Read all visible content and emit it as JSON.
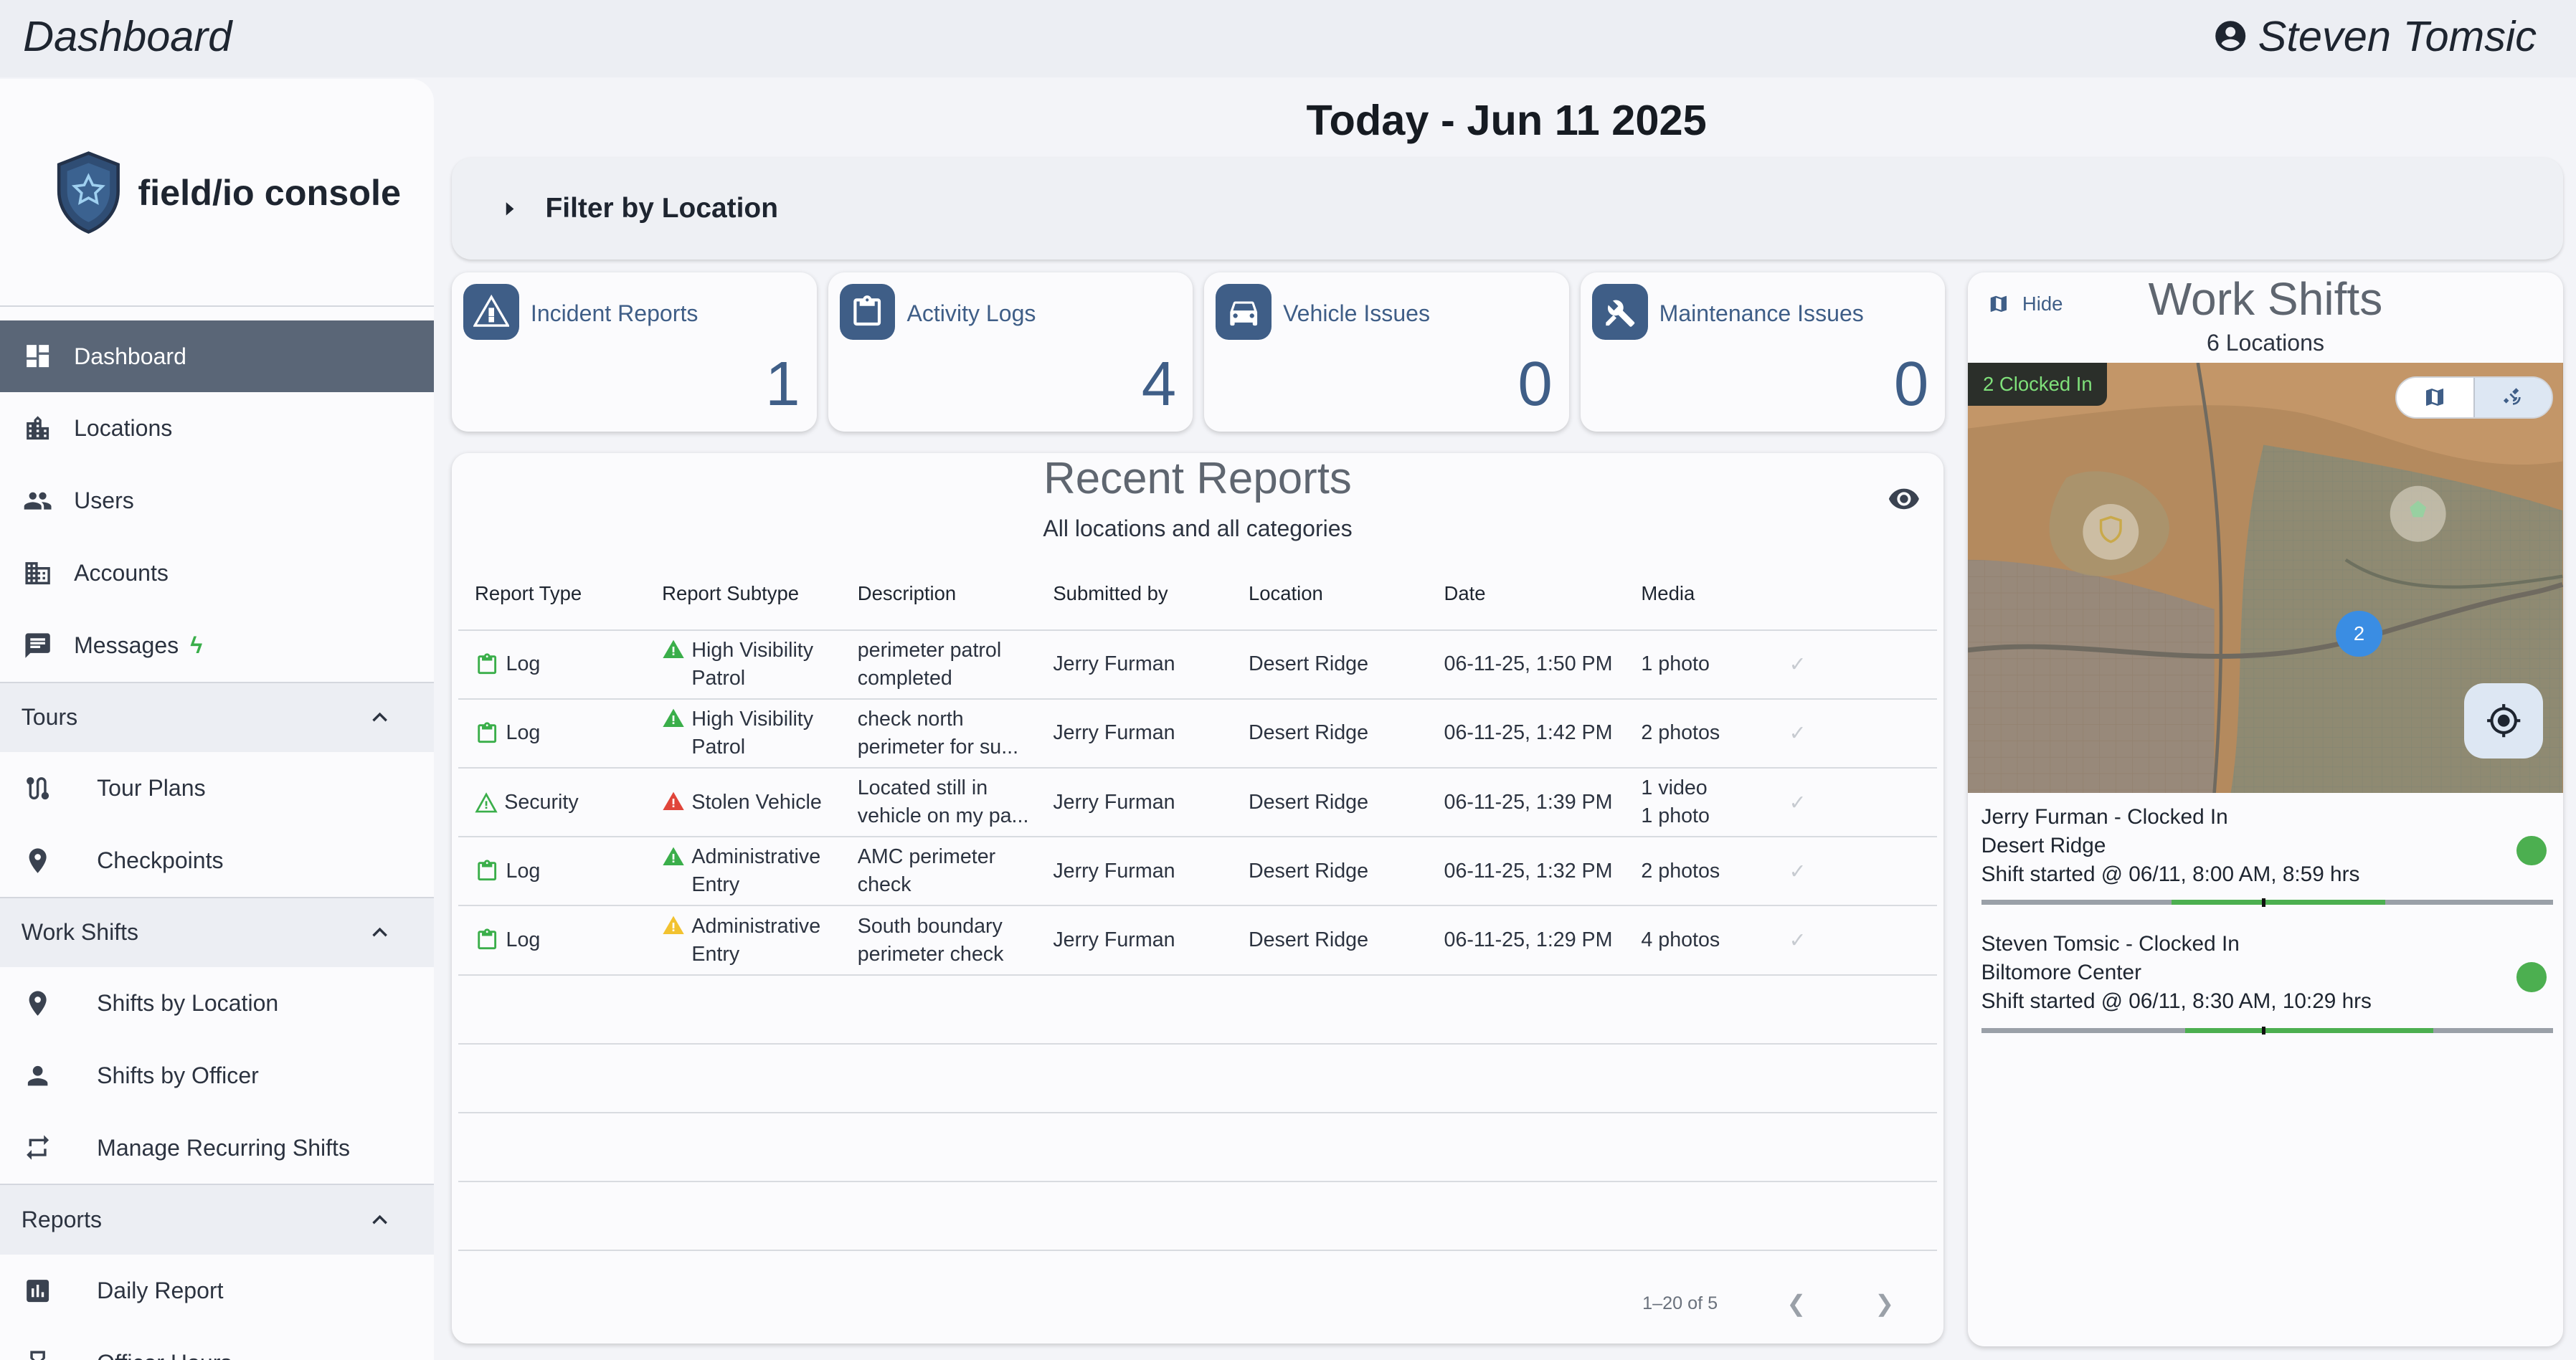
{
  "app": {
    "title": "Dashboard",
    "user": "Steven Tomsic"
  },
  "sidebar": {
    "brand": "field/io console",
    "items": [
      {
        "label": "Dashboard"
      },
      {
        "label": "Locations"
      },
      {
        "label": "Users"
      },
      {
        "label": "Accounts"
      },
      {
        "label": "Messages"
      }
    ],
    "sections": [
      {
        "label": "Tours",
        "items": [
          {
            "label": "Tour Plans"
          },
          {
            "label": "Checkpoints"
          }
        ]
      },
      {
        "label": "Work Shifts",
        "items": [
          {
            "label": "Shifts by Location"
          },
          {
            "label": "Shifts by Officer"
          },
          {
            "label": "Manage Recurring Shifts"
          }
        ]
      },
      {
        "label": "Reports",
        "items": [
          {
            "label": "Daily Report"
          },
          {
            "label": "Officer Hours"
          }
        ]
      }
    ]
  },
  "main": {
    "date_title": "Today - Jun 11 2025",
    "filter_label": "Filter by Location",
    "cards": [
      {
        "label": "Incident Reports",
        "value": "1",
        "icon": "warning-icon"
      },
      {
        "label": "Activity Logs",
        "value": "4",
        "icon": "clipboard-icon"
      },
      {
        "label": "Vehicle Issues",
        "value": "0",
        "icon": "car-icon"
      },
      {
        "label": "Maintenance Issues",
        "value": "0",
        "icon": "tools-icon"
      }
    ],
    "reports": {
      "title": "Recent Reports",
      "subtitle": "All locations and all categories",
      "columns": [
        "Report Type",
        "Report Subtype",
        "Description",
        "Submitted by",
        "Location",
        "Date",
        "Media"
      ],
      "rows": [
        {
          "type": "Log",
          "subtype": [
            "High Visibility",
            "Patrol"
          ],
          "subtype_color": "#3aae4a",
          "desc": [
            "perimeter patrol",
            "completed"
          ],
          "by": "Jerry Furman",
          "loc": "Desert Ridge",
          "date": "06-11-25, 1:50 PM",
          "media": [
            "1 photo",
            ""
          ]
        },
        {
          "type": "Log",
          "subtype": [
            "High Visibility",
            "Patrol"
          ],
          "subtype_color": "#3aae4a",
          "desc": [
            "check north",
            "perimeter for su..."
          ],
          "by": "Jerry Furman",
          "loc": "Desert Ridge",
          "date": "06-11-25, 1:42 PM",
          "media": [
            "2 photos",
            ""
          ]
        },
        {
          "type": "Security",
          "subtype": [
            "Stolen Vehicle",
            ""
          ],
          "subtype_color": "#e0453a",
          "desc": [
            "Located still in",
            "vehicle on my pa..."
          ],
          "by": "Jerry Furman",
          "loc": "Desert Ridge",
          "date": "06-11-25, 1:39 PM",
          "media": [
            "1 video",
            "1 photo"
          ]
        },
        {
          "type": "Log",
          "subtype": [
            "Administrative",
            "Entry"
          ],
          "subtype_color": "#3aae4a",
          "desc": [
            "AMC perimeter",
            "check"
          ],
          "by": "Jerry Furman",
          "loc": "Desert Ridge",
          "date": "06-11-25, 1:32 PM",
          "media": [
            "2 photos",
            ""
          ]
        },
        {
          "type": "Log",
          "subtype": [
            "Administrative",
            "Entry"
          ],
          "subtype_color": "#f2c230",
          "desc": [
            "South boundary",
            "perimeter check"
          ],
          "by": "Jerry Furman",
          "loc": "Desert Ridge",
          "date": "06-11-25, 1:29 PM",
          "media": [
            "4 photos",
            ""
          ]
        }
      ],
      "pagination": "1–20 of 5"
    }
  },
  "shifts": {
    "hide_label": "Hide",
    "title": "Work Shifts",
    "subtitle": "6 Locations",
    "clocked_badge": "2 Clocked In",
    "cluster_count": "2",
    "entries": [
      {
        "name": "Jerry Furman - Clocked In",
        "location": "Desert Ridge",
        "started": "Shift started @ 06/11, 8:00 AM, 8:59 hrs",
        "status_color": "#4caf50"
      },
      {
        "name": "Steven Tomsic - Clocked In",
        "location": "Biltomore Center",
        "started": "Shift started @ 06/11, 8:30 AM, 10:29 hrs",
        "status_color": "#4caf50"
      }
    ]
  },
  "colors": {
    "accent": "#3f5e87",
    "active_nav": "#5a6677",
    "success": "#4caf50"
  }
}
